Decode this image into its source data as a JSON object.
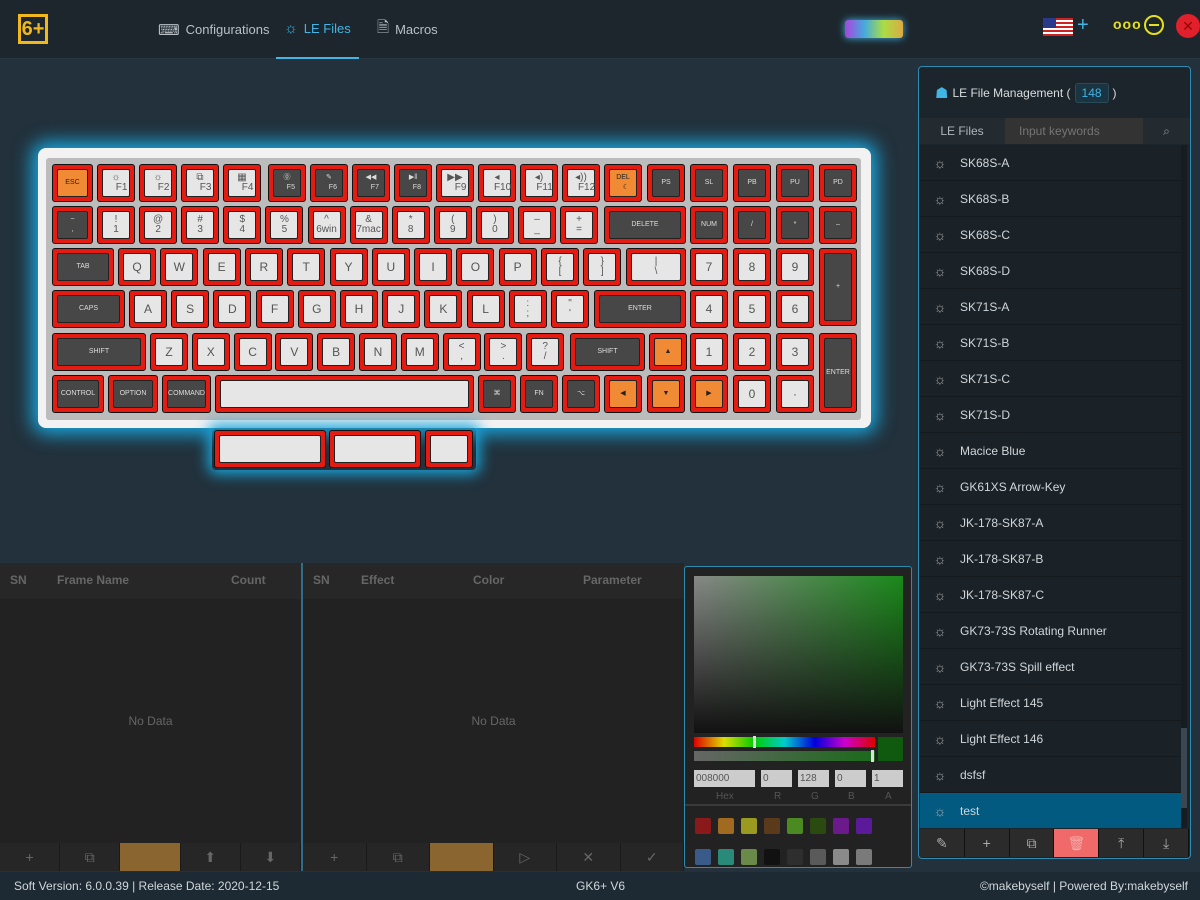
{
  "app": {
    "logo": "6+"
  },
  "nav": [
    {
      "label": "Configurations",
      "icon": "keyboard-icon"
    },
    {
      "label": "LE Files",
      "icon": "bulb-icon",
      "active": true
    },
    {
      "label": "Macros",
      "icon": "document-icon"
    }
  ],
  "keyboard": {
    "colors": {
      "frame": "#e51b12",
      "light": "#e6e6e6",
      "dark": "#474747",
      "orange": "#f08a34",
      "glow": "#1aa8e0"
    },
    "rows": [
      [
        [
          "ESC",
          "orange"
        ],
        [
          "☼\n    F1",
          "light"
        ],
        [
          "☼\n    F2",
          "light"
        ],
        [
          "⧉\n    F3",
          "light"
        ],
        [
          "▦\n    F4",
          "light"
        ],
        [
          "⓪\n    F5",
          "dark"
        ],
        [
          "✎\n    F6",
          "dark"
        ],
        [
          "◀◀\n    F7",
          "dark"
        ],
        [
          "▶‖\n    F8",
          "dark"
        ],
        [
          "▶▶\n    F9",
          "light"
        ],
        [
          "◂\n    F10",
          "light"
        ],
        [
          "◂)\n    F11",
          "light"
        ],
        [
          "◂))\n    F12",
          "light"
        ],
        [
          "DEL\n   ☾",
          "orange"
        ],
        [
          "PS",
          "dark"
        ],
        [
          "SL",
          "dark"
        ],
        [
          "PB",
          "dark"
        ],
        [
          "PU",
          "dark"
        ],
        [
          "PD",
          "dark"
        ]
      ],
      [
        [
          "~\n,",
          "dark"
        ],
        [
          "!\n1",
          "light"
        ],
        [
          "@\n2",
          "light"
        ],
        [
          "#\n3",
          "light"
        ],
        [
          "$\n4",
          "light"
        ],
        [
          "%\n5",
          "light"
        ],
        [
          "^\n6win",
          "light"
        ],
        [
          "&\n7mac",
          "light"
        ],
        [
          "*\n8",
          "light"
        ],
        [
          "(\n9",
          "light"
        ],
        [
          ")\n0",
          "light"
        ],
        [
          "–\n_",
          "light"
        ],
        [
          "+\n=",
          "light"
        ],
        [
          "DELETE",
          "dark"
        ],
        [
          "NUM",
          "dark"
        ],
        [
          "/",
          "dark"
        ],
        [
          "*",
          "dark"
        ],
        [
          "–",
          "dark"
        ]
      ],
      [
        [
          "TAB",
          "dark"
        ],
        [
          "Q",
          "light"
        ],
        [
          "W",
          "light"
        ],
        [
          "E",
          "light"
        ],
        [
          "R",
          "light"
        ],
        [
          "T",
          "light"
        ],
        [
          "Y",
          "light"
        ],
        [
          "U",
          "light"
        ],
        [
          "I",
          "light"
        ],
        [
          "O",
          "light"
        ],
        [
          "P",
          "light"
        ],
        [
          "{\n[",
          "light"
        ],
        [
          "}\n]",
          "light"
        ],
        [
          "|\n\\",
          "light"
        ],
        [
          "7",
          "light"
        ],
        [
          "8",
          "light"
        ],
        [
          "9",
          "light"
        ],
        [
          "+",
          "dark"
        ]
      ],
      [
        [
          "CAPS",
          "dark"
        ],
        [
          "A",
          "light"
        ],
        [
          "S",
          "light"
        ],
        [
          "D",
          "light"
        ],
        [
          "F",
          "light"
        ],
        [
          "G",
          "light"
        ],
        [
          "H",
          "light"
        ],
        [
          "J",
          "light"
        ],
        [
          "K",
          "light"
        ],
        [
          "L",
          "light"
        ],
        [
          ":\n;",
          "light"
        ],
        [
          "\"\n'",
          "light"
        ],
        [
          "ENTER",
          "dark"
        ],
        [
          "4",
          "light"
        ],
        [
          "5",
          "light"
        ],
        [
          "6",
          "light"
        ]
      ],
      [
        [
          "SHIFT",
          "dark"
        ],
        [
          "Z",
          "light"
        ],
        [
          "X",
          "light"
        ],
        [
          "C",
          "light"
        ],
        [
          "V",
          "light"
        ],
        [
          "B",
          "light"
        ],
        [
          "N",
          "light"
        ],
        [
          "M",
          "light"
        ],
        [
          "<\n,",
          "light"
        ],
        [
          ">\n.",
          "light"
        ],
        [
          "?\n/",
          "light"
        ],
        [
          "SHIFT",
          "dark"
        ],
        [
          "▲",
          "orange"
        ],
        [
          "1",
          "light"
        ],
        [
          "2",
          "light"
        ],
        [
          "3",
          "light"
        ],
        [
          "ENTER",
          "dark"
        ]
      ],
      [
        [
          "CONTROL",
          "dark"
        ],
        [
          "OPTION",
          "dark"
        ],
        [
          "COMMAND",
          "dark"
        ],
        [
          "",
          "light"
        ],
        [
          "⌘",
          "dark"
        ],
        [
          "FN",
          "dark"
        ],
        [
          "⌥",
          "dark"
        ],
        [
          "◀",
          "orange"
        ],
        [
          "▼",
          "orange"
        ],
        [
          "▶",
          "orange"
        ],
        [
          "0",
          "light"
        ],
        [
          "·",
          "light"
        ]
      ],
      [
        [
          "",
          "light"
        ],
        [
          "",
          "light"
        ],
        [
          "",
          "light"
        ]
      ]
    ]
  },
  "frames": {
    "headers": [
      "SN",
      "Frame Name",
      "Count"
    ],
    "empty": "No Data",
    "toolbar": [
      "+",
      "⧉",
      "🗑",
      "⬆",
      "⬇"
    ]
  },
  "effects": {
    "headers": [
      "SN",
      "Effect",
      "Color",
      "Parameter"
    ],
    "empty": "No Data",
    "toolbar": [
      "+",
      "⧉",
      "🗑",
      "▷",
      "✕",
      "✓"
    ]
  },
  "color_picker": {
    "hex": "008000",
    "r": "0",
    "g": "128",
    "b": "0",
    "a": "1",
    "labels": [
      "Hex",
      "R",
      "G",
      "B",
      "A"
    ],
    "presets": [
      "#8a1a1a",
      "#a06a20",
      "#9a9a20",
      "#5a3a1a",
      "#4a8a20",
      "#2a4a10",
      "#6a1a8a",
      "#5a1a9a",
      "#3a5a8a",
      "#2a8a7a",
      "#6a8a4a",
      "#111111",
      "#2e2e2e",
      "#5a5a5a",
      "#8a8a8a",
      "#7a7a7a"
    ]
  },
  "le_panel": {
    "title": "LE File Management (",
    "count": "148",
    "close_paren": ")",
    "tab": "LE Files",
    "search_placeholder": "Input keywords",
    "items": [
      "SK68S-A",
      "SK68S-B",
      "SK68S-C",
      "SK68S-D",
      "SK71S-A",
      "SK71S-B",
      "SK71S-C",
      "SK71S-D",
      "Macice Blue",
      "GK61XS Arrow-Key",
      "JK-178-SK87-A",
      "JK-178-SK87-B",
      "JK-178-SK87-C",
      "GK73-73S Rotating Runner",
      "GK73-73S Spill effect",
      "Light Effect 145",
      "Light Effect 146",
      "dsfsf",
      "test"
    ],
    "selected": "test",
    "toolbar": [
      "✎",
      "+",
      "⧉",
      "🗑",
      "⤒",
      "⤓"
    ]
  },
  "status": {
    "left": "Soft Version: 6.0.0.39 |  Release Date: 2020-12-15",
    "center": "GK6+ V6",
    "right": "©makebyself |  Powered By:makebyself"
  }
}
